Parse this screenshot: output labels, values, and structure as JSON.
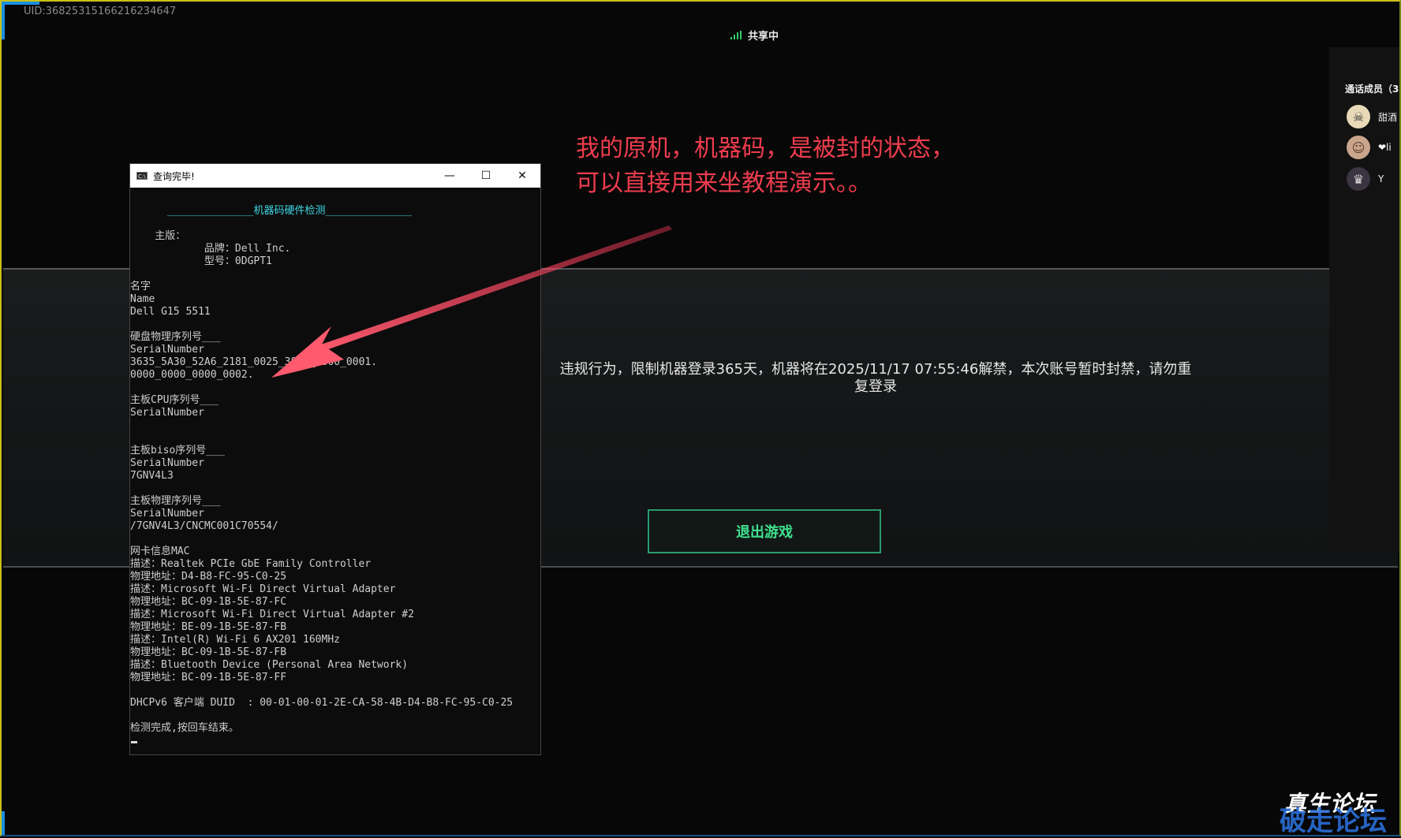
{
  "uid": "UID:3682531516621623464​7",
  "header": {
    "sharing_label": "共享中"
  },
  "annotation": {
    "line1": "我的原机，机器码，是被封的状态，",
    "line2": "可以直接用来坐教程演示。。"
  },
  "game_dialog": {
    "ban_message_line1": "违规行为，限制机器登录365天，机器将在2025/11/17 07:55:46解禁，本次账号暂时封禁，请勿重",
    "ban_message_line2": "复登录",
    "exit_button": "退出游戏"
  },
  "call_panel": {
    "title": "通话成员（3",
    "members": [
      {
        "name": "甜酒",
        "avatar_icon": "skull-avatar-icon"
      },
      {
        "name": "❤li",
        "avatar_icon": "cat-avatar-icon"
      },
      {
        "name": "Y",
        "avatar_icon": "girl-avatar-icon"
      }
    ]
  },
  "console": {
    "title": "查询完毕!",
    "lines": [
      {
        "t": "      ______________机器码硬件检测______________",
        "color": "#3fd7e6"
      },
      {
        "t": "",
        "color": "#cfcfcf"
      },
      {
        "t": "    主版：",
        "color": "#cfcfcf"
      },
      {
        "t": "            品牌：Dell Inc.",
        "color": "#cfcfcf"
      },
      {
        "t": "            型号：0DGPT1",
        "color": "#cfcfcf"
      },
      {
        "t": "",
        "color": "#cfcfcf"
      },
      {
        "t": "名字",
        "color": "#cfcfcf"
      },
      {
        "t": "Name",
        "color": "#cfcfcf"
      },
      {
        "t": "Dell G15 5511",
        "color": "#cfcfcf"
      },
      {
        "t": "",
        "color": "#cfcfcf"
      },
      {
        "t": "硬盘物理序列号___",
        "color": "#cfcfcf"
      },
      {
        "t": "SerialNumber",
        "color": "#cfcfcf"
      },
      {
        "t": "3635_5A30_52A6_2181_0025_3800_0000_0001.",
        "color": "#cfcfcf"
      },
      {
        "t": "0000_0000_0000_0002.",
        "color": "#cfcfcf"
      },
      {
        "t": "",
        "color": "#cfcfcf"
      },
      {
        "t": "主板CPU序列号___",
        "color": "#cfcfcf"
      },
      {
        "t": "SerialNumber",
        "color": "#cfcfcf"
      },
      {
        "t": "",
        "color": "#cfcfcf"
      },
      {
        "t": "",
        "color": "#cfcfcf"
      },
      {
        "t": "主板biso序列号___",
        "color": "#cfcfcf"
      },
      {
        "t": "SerialNumber",
        "color": "#cfcfcf"
      },
      {
        "t": "7GNV4L3",
        "color": "#cfcfcf"
      },
      {
        "t": "",
        "color": "#cfcfcf"
      },
      {
        "t": "主板物理序列号___",
        "color": "#cfcfcf"
      },
      {
        "t": "SerialNumber",
        "color": "#cfcfcf"
      },
      {
        "t": "/7GNV4L3/CNCMC001C70554/",
        "color": "#cfcfcf"
      },
      {
        "t": "",
        "color": "#cfcfcf"
      },
      {
        "t": "网卡信息MAC",
        "color": "#cfcfcf"
      },
      {
        "t": "描述：Realtek PCIe GbE Family Controller",
        "color": "#cfcfcf"
      },
      {
        "t": "物理地址：D4-B8-FC-95-C0-25",
        "color": "#cfcfcf"
      },
      {
        "t": "描述：Microsoft Wi-Fi Direct Virtual Adapter",
        "color": "#cfcfcf"
      },
      {
        "t": "物理地址：BC-09-1B-5E-87-FC",
        "color": "#cfcfcf"
      },
      {
        "t": "描述：Microsoft Wi-Fi Direct Virtual Adapter #2",
        "color": "#cfcfcf"
      },
      {
        "t": "物理地址：BE-09-1B-5E-87-FB",
        "color": "#cfcfcf"
      },
      {
        "t": "描述：Intel(R) Wi-Fi 6 AX201 160MHz",
        "color": "#cfcfcf"
      },
      {
        "t": "物理地址：BC-09-1B-5E-87-FB",
        "color": "#cfcfcf"
      },
      {
        "t": "描述：Bluetooth Device (Personal Area Network)",
        "color": "#cfcfcf"
      },
      {
        "t": "物理地址：BC-09-1B-5E-87-FF",
        "color": "#cfcfcf"
      },
      {
        "t": "",
        "color": "#cfcfcf"
      },
      {
        "t": "DHCPv6 客户端 DUID  : 00-01-00-01-2E-CA-58-4B-D4-B8-FC-95-C0-25",
        "color": "#cfcfcf"
      },
      {
        "t": "",
        "color": "#cfcfcf"
      },
      {
        "t": "检测完成,按回车结束。",
        "color": "#cfcfcf"
      }
    ]
  },
  "watermark": {
    "line1": "真生论坛",
    "line2": "破走论坛"
  },
  "colors": {
    "accent_green": "#3fe28f",
    "annotation_red": "#ee3d4e",
    "console_cyan": "#3fd7e6",
    "frame_blue": "#1a8fe0"
  }
}
